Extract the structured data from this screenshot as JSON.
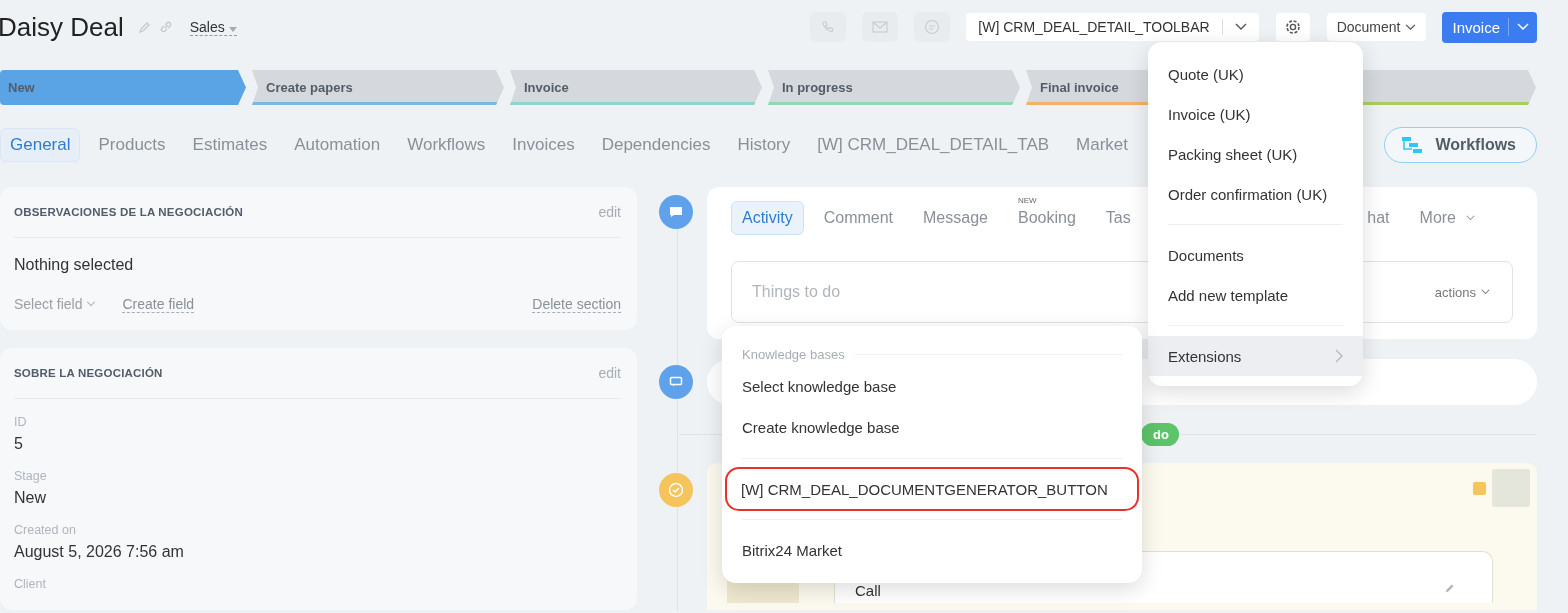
{
  "header": {
    "title": "Daisy Deal",
    "pipeline": "Sales",
    "toolbar_select": "[W] CRM_DEAL_DETAIL_TOOLBAR",
    "document_button": "Document",
    "invoice_button": "Invoice"
  },
  "stages": [
    {
      "label": "New",
      "color": "#5aa4e6",
      "selected": true
    },
    {
      "label": "Create papers",
      "color": "#7ab8e0",
      "selected": false
    },
    {
      "label": "Invoice",
      "color": "#8fd3cf",
      "selected": false
    },
    {
      "label": "In progress",
      "color": "#93d7b0",
      "selected": false
    },
    {
      "label": "Final invoice",
      "color": "#f2b26a",
      "selected": false
    },
    {
      "color": "#a6cf5b",
      "selected": false
    }
  ],
  "tabs": [
    {
      "label": "General",
      "selected": true
    },
    {
      "label": "Products",
      "selected": false
    },
    {
      "label": "Estimates",
      "selected": false
    },
    {
      "label": "Automation",
      "selected": false
    },
    {
      "label": "Workflows",
      "selected": false
    },
    {
      "label": "Invoices",
      "selected": false
    },
    {
      "label": "Dependencies",
      "selected": false
    },
    {
      "label": "History",
      "selected": false
    },
    {
      "label": "[W] CRM_DEAL_DETAIL_TAB",
      "selected": false
    },
    {
      "label": "Market",
      "selected": false
    }
  ],
  "workflows_button": "Workflows",
  "sections": [
    {
      "title": "OBSERVACIONES DE LA NEGOCIACIÓN",
      "edit": "edit",
      "kind": "empty",
      "empty_text": "Nothing selected",
      "select_field": "Select field",
      "create_field": "Create field",
      "delete_section": "Delete section"
    },
    {
      "title": "SOBRE LA NEGOCIACIÓN",
      "edit": "edit",
      "kind": "fields",
      "fields": [
        {
          "label": "ID",
          "value": "5"
        },
        {
          "label": "Stage",
          "value": "New"
        },
        {
          "label": "Created on",
          "value": "August 5, 2026 7:56 am"
        },
        {
          "label": "Client"
        }
      ]
    }
  ],
  "composer": {
    "tabs": [
      {
        "label": "Activity",
        "selected": true
      },
      {
        "label": "Comment",
        "selected": false
      },
      {
        "label": "Message",
        "selected": false
      },
      {
        "label": "Booking",
        "badge": "NEW",
        "selected": false
      },
      {
        "label": "Tas",
        "selected": false
      }
    ],
    "tabs_right": [
      {
        "label": "hat",
        "selected": false
      },
      {
        "label": "More",
        "selected": false
      }
    ],
    "placeholder": "Things to do",
    "actions": "actions"
  },
  "timeline_badge": "do",
  "activity": {
    "field": "Call"
  },
  "document_menu": {
    "items": [
      {
        "label": "Quote (UK)",
        "kind": "item"
      },
      {
        "label": "Invoice (UK)",
        "kind": "item"
      },
      {
        "label": "Packing sheet (UK)",
        "kind": "item"
      },
      {
        "label": "Order confirmation (UK)",
        "kind": "item"
      },
      {
        "kind": "divider"
      },
      {
        "label": "Documents",
        "kind": "item"
      },
      {
        "label": "Add new template",
        "kind": "item"
      },
      {
        "kind": "divider"
      },
      {
        "label": "Extensions",
        "kind": "submenu",
        "selected": true
      }
    ]
  },
  "extensions_menu": {
    "items": [
      {
        "label": "Knowledge bases",
        "kind": "header"
      },
      {
        "label": "Select knowledge base",
        "kind": "item",
        "highlighted": false
      },
      {
        "label": "Create knowledge base",
        "kind": "item",
        "highlighted": false
      },
      {
        "kind": "divider"
      },
      {
        "label": "[W] CRM_DEAL_DOCUMENTGENERATOR_BUTTON",
        "kind": "item",
        "highlighted": true
      },
      {
        "kind": "divider"
      },
      {
        "label": "Bitrix24 Market",
        "kind": "item",
        "highlighted": false
      }
    ]
  }
}
